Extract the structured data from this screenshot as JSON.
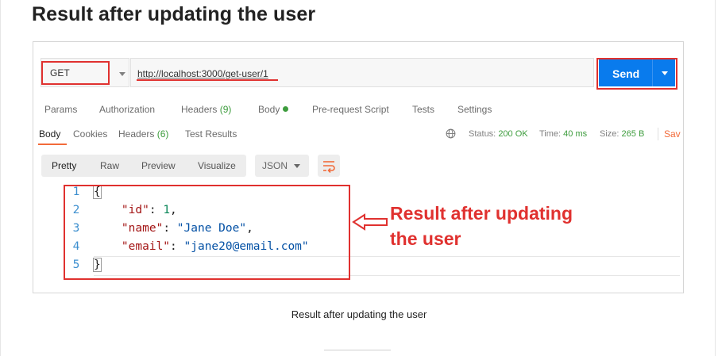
{
  "article": {
    "title": "Result after updating the user",
    "caption": "Result after updating the user"
  },
  "request": {
    "method": "GET",
    "url": "http://localhost:3000/get-user/1",
    "send_label": "Send"
  },
  "request_tabs": {
    "params": "Params",
    "authorization": "Authorization",
    "headers": "Headers",
    "headers_count": "(9)",
    "body": "Body",
    "pre_request": "Pre-request Script",
    "tests": "Tests",
    "settings": "Settings"
  },
  "response_tabs": {
    "body": "Body",
    "cookies": "Cookies",
    "headers": "Headers",
    "headers_count": "(6)",
    "test_results": "Test Results"
  },
  "response_status": {
    "status_label": "Status:",
    "status_value": "200 OK",
    "time_label": "Time:",
    "time_value": "40 ms",
    "size_label": "Size:",
    "size_value": "265 B",
    "save_label": "Sav"
  },
  "view_options": {
    "pretty": "Pretty",
    "raw": "Raw",
    "preview": "Preview",
    "visualize": "Visualize",
    "format": "JSON"
  },
  "code": {
    "line_numbers": [
      "1",
      "2",
      "3",
      "4",
      "5"
    ],
    "open_brace": "{",
    "close_brace": "}",
    "key_id": "\"id\"",
    "val_id": "1",
    "key_name": "\"name\"",
    "val_name": "\"Jane Doe\"",
    "key_email": "\"email\"",
    "val_email": "\"jane20@email.com\""
  },
  "annotation": {
    "line1": "Result after updating",
    "line2": "the user"
  },
  "colors": {
    "accent_blue": "#097bed",
    "highlight_red": "#e0312f",
    "status_green": "#3d9c3d",
    "tab_orange": "#f26b3a"
  },
  "icons": [
    "chevron-down-icon",
    "caret-down-icon",
    "globe-icon",
    "wrap-lines-icon",
    "arrow-left-icon"
  ]
}
